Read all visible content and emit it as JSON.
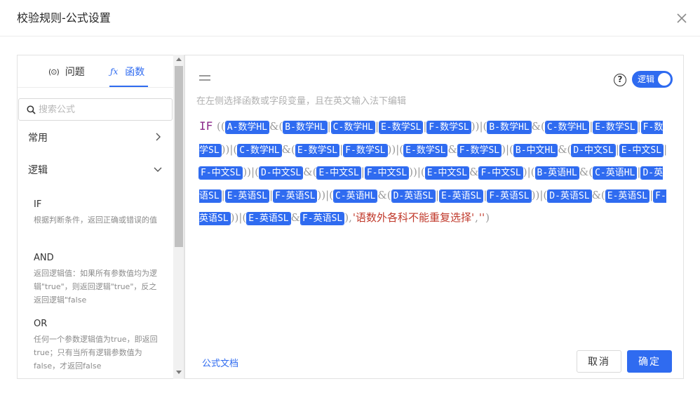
{
  "dialog": {
    "title": "校验规则-公式设置"
  },
  "left_panel": {
    "tabs": [
      {
        "icon_text": "(⊙)",
        "label": "问题"
      },
      {
        "icon_text": "ƒx",
        "label": "函数"
      }
    ],
    "search": {
      "placeholder": "搜索公式"
    },
    "categories": [
      {
        "label": "常用",
        "expanded": false
      },
      {
        "label": "逻辑",
        "expanded": true
      }
    ],
    "functions": [
      {
        "name": "IF",
        "desc": "根据判断条件，返回正确或错误的值"
      },
      {
        "name": "AND",
        "desc": "返回逻辑值：如果所有参数值均为逻辑\"true\"，则返回逻辑\"true\"，反之返回逻辑\"false"
      },
      {
        "name": "OR",
        "desc": "任何一个参数逻辑值为true，即返回true；只有当所有逻辑参数值为false，才返回false"
      }
    ]
  },
  "editor": {
    "help_icon_text": "?",
    "logic_toggle_label": "逻辑",
    "hint": "在左侧选择函数或字段变量，且在英文输入法下编辑",
    "formula_fn": "IF",
    "formula_tokens": [
      {
        "t": "op",
        "v": "(("
      },
      {
        "t": "var",
        "v": "A-数学HL"
      },
      {
        "t": "op",
        "v": "&("
      },
      {
        "t": "var",
        "v": "B-数学HL"
      },
      {
        "t": "op",
        "v": "|"
      },
      {
        "t": "var",
        "v": "C-数学HL"
      },
      {
        "t": "op",
        "v": "|"
      },
      {
        "t": "var",
        "v": "E-数学SL"
      },
      {
        "t": "op",
        "v": "|"
      },
      {
        "t": "var",
        "v": "F-数学SL"
      },
      {
        "t": "op",
        "v": "))|("
      },
      {
        "t": "var",
        "v": "B-数学HL"
      },
      {
        "t": "op",
        "v": "&("
      },
      {
        "t": "var",
        "v": "C-数学HL"
      },
      {
        "t": "op",
        "v": "|"
      },
      {
        "t": "var",
        "v": "E-数学SL"
      },
      {
        "t": "op",
        "v": "|"
      },
      {
        "t": "var",
        "v": "F-数学SL"
      },
      {
        "t": "op",
        "v": "))|("
      },
      {
        "t": "var",
        "v": "C-数学HL"
      },
      {
        "t": "op",
        "v": "&("
      },
      {
        "t": "var",
        "v": "E-数学SL"
      },
      {
        "t": "op",
        "v": "|"
      },
      {
        "t": "var",
        "v": "F-数学SL"
      },
      {
        "t": "op",
        "v": "))|("
      },
      {
        "t": "var",
        "v": "E-数学SL"
      },
      {
        "t": "op",
        "v": "&"
      },
      {
        "t": "var",
        "v": "F-数学SL"
      },
      {
        "t": "op",
        "v": ")|("
      },
      {
        "t": "var",
        "v": "B-中文HL"
      },
      {
        "t": "op",
        "v": "&("
      },
      {
        "t": "var",
        "v": "D-中文SL"
      },
      {
        "t": "op",
        "v": "|"
      },
      {
        "t": "var",
        "v": "E-中文SL"
      },
      {
        "t": "op",
        "v": "|"
      },
      {
        "t": "var",
        "v": "F-中文SL"
      },
      {
        "t": "op",
        "v": "))|("
      },
      {
        "t": "var",
        "v": "D-中文SL"
      },
      {
        "t": "op",
        "v": "&("
      },
      {
        "t": "var",
        "v": "E-中文SL"
      },
      {
        "t": "op",
        "v": "|"
      },
      {
        "t": "var",
        "v": "F-中文SL"
      },
      {
        "t": "op",
        "v": "))|("
      },
      {
        "t": "var",
        "v": "E-中文SL"
      },
      {
        "t": "op",
        "v": "&"
      },
      {
        "t": "var",
        "v": "F-中文SL"
      },
      {
        "t": "op",
        "v": ")|("
      },
      {
        "t": "var",
        "v": "B-英语HL"
      },
      {
        "t": "op",
        "v": "&("
      },
      {
        "t": "var",
        "v": "C-英语HL"
      },
      {
        "t": "op",
        "v": "|"
      },
      {
        "t": "var",
        "v": "D-英语SL"
      },
      {
        "t": "op",
        "v": "|"
      },
      {
        "t": "var",
        "v": "E-英语SL"
      },
      {
        "t": "op",
        "v": "|"
      },
      {
        "t": "var",
        "v": "F-英语SL"
      },
      {
        "t": "op",
        "v": "))|("
      },
      {
        "t": "var",
        "v": "C-英语HL"
      },
      {
        "t": "op",
        "v": "&("
      },
      {
        "t": "var",
        "v": "D-英语SL"
      },
      {
        "t": "op",
        "v": "|"
      },
      {
        "t": "var",
        "v": "E-英语SL"
      },
      {
        "t": "op",
        "v": "|"
      },
      {
        "t": "var",
        "v": "F-英语SL"
      },
      {
        "t": "op",
        "v": "))|("
      },
      {
        "t": "var",
        "v": "D-英语SL"
      },
      {
        "t": "op",
        "v": "&("
      },
      {
        "t": "var",
        "v": "E-英语SL"
      },
      {
        "t": "op",
        "v": "|"
      },
      {
        "t": "var",
        "v": "F-英语SL"
      },
      {
        "t": "op",
        "v": "))|("
      },
      {
        "t": "var",
        "v": "E-英语SL"
      },
      {
        "t": "op",
        "v": "&"
      },
      {
        "t": "var",
        "v": "F-英语SL"
      },
      {
        "t": "op",
        "v": "),"
      },
      {
        "t": "str",
        "v": "'语数外各科不能重复选择'"
      },
      {
        "t": "op",
        "v": ","
      },
      {
        "t": "str",
        "v": "''"
      },
      {
        "t": "op",
        "v": ")"
      }
    ],
    "doc_link": "公式文档",
    "cancel_label": "取消",
    "ok_label": "确定"
  },
  "colors": {
    "accent": "#2f6bf0",
    "function_keyword": "#8b2a8b",
    "string_literal": "#c0392b"
  }
}
